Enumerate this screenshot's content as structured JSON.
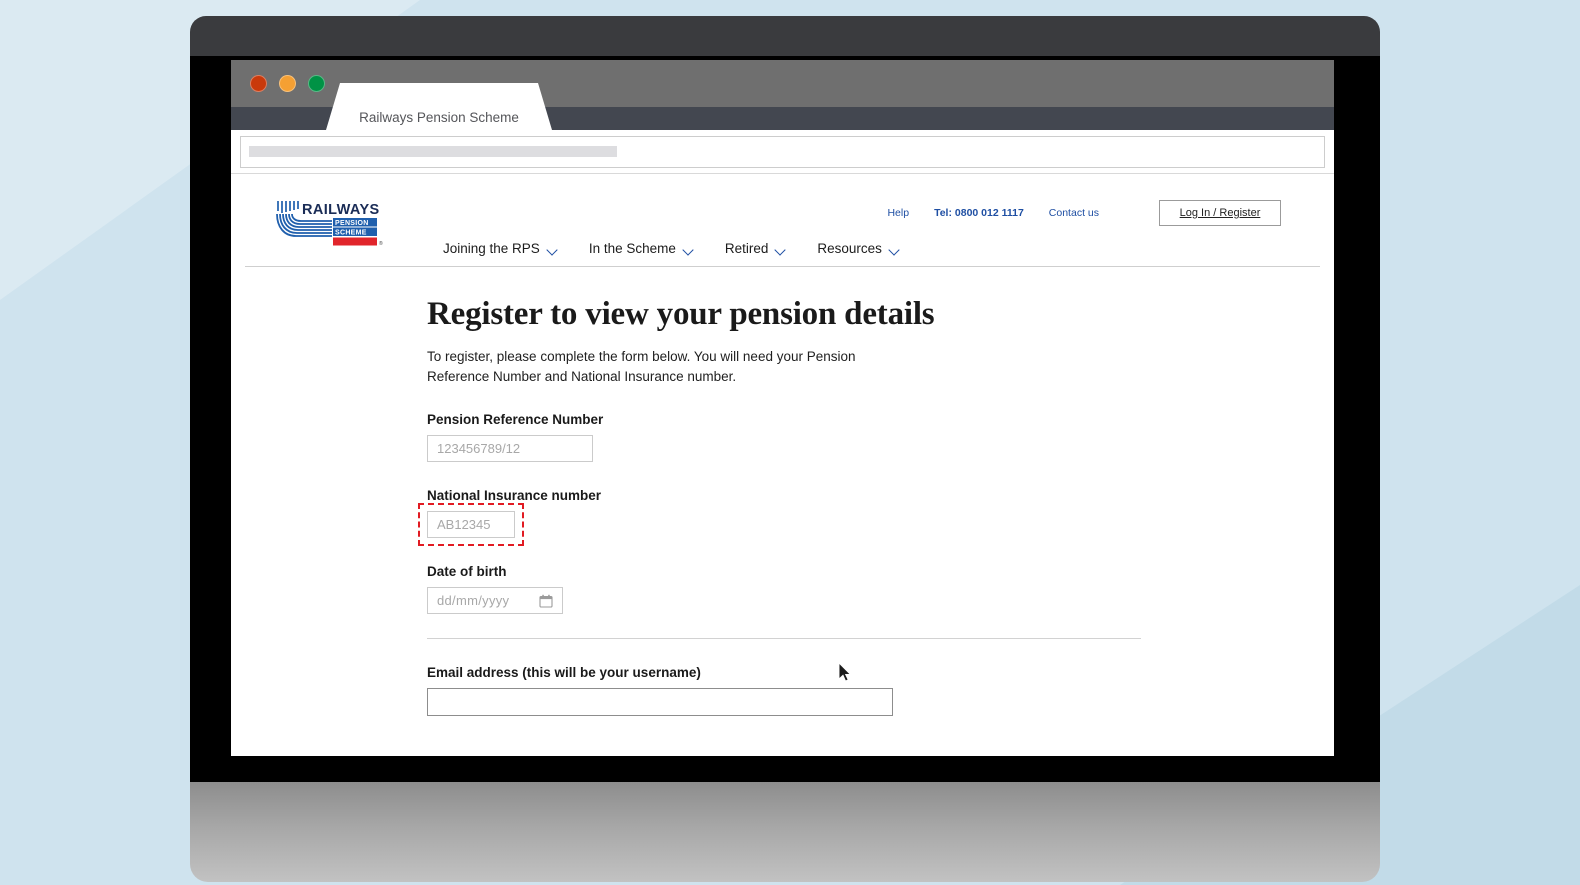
{
  "browser": {
    "tab_title": "Railways Pension Scheme",
    "url_value": "",
    "url_placeholder": "",
    "traffic_lights": [
      {
        "name": "close",
        "color": "#c9390b"
      },
      {
        "name": "minimize",
        "color": "#f5a033"
      },
      {
        "name": "maximize",
        "color": "#009245"
      }
    ]
  },
  "site": {
    "logo": {
      "primary_text": "RAILWAYS",
      "secondary_line1": "PENSION",
      "secondary_line2": "SCHEME",
      "mark_color": "#1f5fad",
      "accent_color": "#e1252b"
    },
    "utility_nav": [
      {
        "label": "Help",
        "bold": false
      },
      {
        "label": "Tel: 0800 012 1117",
        "bold": true
      },
      {
        "label": "Contact us",
        "bold": false
      }
    ],
    "login_button_label": "Log In / Register",
    "main_nav": [
      {
        "label": "Joining the RPS"
      },
      {
        "label": "In the Scheme"
      },
      {
        "label": "Retired"
      },
      {
        "label": "Resources"
      }
    ]
  },
  "content": {
    "title": "Register to view your pension details",
    "intro": "To register, please complete the form below. You will need your Pension Reference Number and National Insurance number.",
    "fields": {
      "pension_reference": {
        "label": "Pension Reference Number",
        "placeholder": "123456789/12",
        "value": ""
      },
      "national_insurance": {
        "label": "National Insurance number",
        "placeholder": "AB12345",
        "value": "",
        "highlighted": true,
        "highlight_color": "#e11b22"
      },
      "date_of_birth": {
        "label": "Date of birth",
        "placeholder": "dd/mm/yyyy",
        "value": ""
      },
      "email": {
        "label": "Email address (this will be your username)",
        "placeholder": "",
        "value": ""
      }
    }
  },
  "theme": {
    "link_blue": "#1f4fa3",
    "page_background": "#ffffff",
    "desktop_background": "#cfe3ee",
    "bezel": "#3a3b3e"
  }
}
